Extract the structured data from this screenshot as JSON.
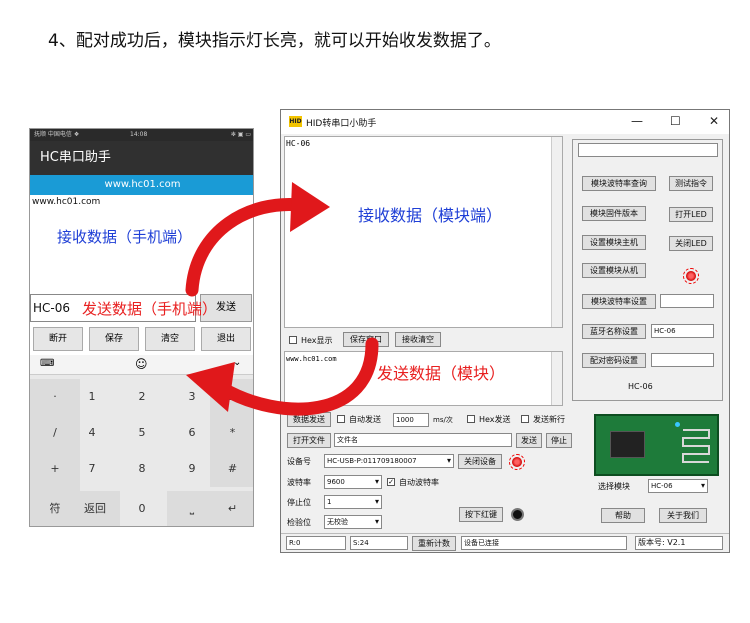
{
  "heading": "4、配对成功后，模块指示灯长亮，就可以开始收发数据了。",
  "phone": {
    "status_left": "抚顺 中国电信 ❖",
    "status_time": "14:08",
    "status_right": "✻ ▣ ▭",
    "title": "HC串口助手",
    "url_bar": "www.hc01.com",
    "received_text": "www.hc01.com",
    "receive_label": "接收数据（手机端）",
    "input_value": "HC-06",
    "send_label": "发送数据（手机端）",
    "send_button": "发送",
    "buttons": [
      "断开",
      "保存",
      "清空",
      "退出"
    ],
    "keyboard": {
      "toolbar_icons": [
        "keyboard-icon",
        "emoji-icon",
        "hide-keyboard-icon"
      ],
      "side_keys": [
        "·",
        "/",
        "+",
        "-"
      ],
      "digits": [
        "1",
        "2",
        "3",
        "4",
        "5",
        "6",
        "7",
        "8",
        "9"
      ],
      "right_keys": [
        "⌫",
        "*",
        "#"
      ],
      "bottom_row": [
        "符",
        "返回",
        "0",
        "⎵",
        "↵"
      ]
    }
  },
  "window": {
    "title": "HID转串口小助手",
    "hid_badge": "HID",
    "receive_text": "HC-06",
    "receive_label": "接收数据（模块端）",
    "hex_display": "Hex显示",
    "save_window": "保存窗口",
    "clear_receive": "接收清空",
    "send_text": "www.hc01.com",
    "send_label": "发送数据（模块）",
    "send_data_btn": "数据发送",
    "auto_send": "自动发送",
    "interval_value": "1000",
    "interval_unit": "ms/次",
    "hex_send": "Hex发送",
    "send_newline": "发送新行",
    "open_file": "打开文件",
    "file_name": "文件名",
    "send_btn": "发送",
    "stop_btn": "停止",
    "device_label": "设备号",
    "device_value": "HC-USB-P:011709180007",
    "close_device": "关闭设备",
    "baud_label": "波特率",
    "baud_value": "9600",
    "auto_baud": "自动波特率",
    "stopbit_label": "停止位",
    "stopbit_value": "1",
    "parity_label": "检验位",
    "parity_value": "无校验",
    "press_red_key": "按下红键",
    "panel": {
      "query_baud": "模块波特率查询",
      "test_cmd": "测试指令",
      "firmware": "模块固件版本",
      "led_on": "打开LED",
      "set_master": "设置模块主机",
      "led_off": "关闭LED",
      "set_slave": "设置模块从机",
      "set_baud": "模块波特率设置",
      "bt_name_set": "蓝牙名称设置",
      "bt_name_value": "HC-06",
      "pair_pwd_set": "配对密码设置",
      "module_name": "HC-06"
    },
    "select_module_label": "选择模块",
    "select_module_value": "HC-06",
    "help_btn": "帮助",
    "about_btn": "关于我们",
    "status_r": "R:0",
    "status_s": "S:24",
    "reset_count": "重新计数",
    "status_connected": "设备已连接",
    "version": "版本号: V2.1"
  },
  "colors": {
    "accent_blue": "#1f3fd6",
    "accent_red": "#e82020",
    "arrow_red": "#e0181b"
  }
}
